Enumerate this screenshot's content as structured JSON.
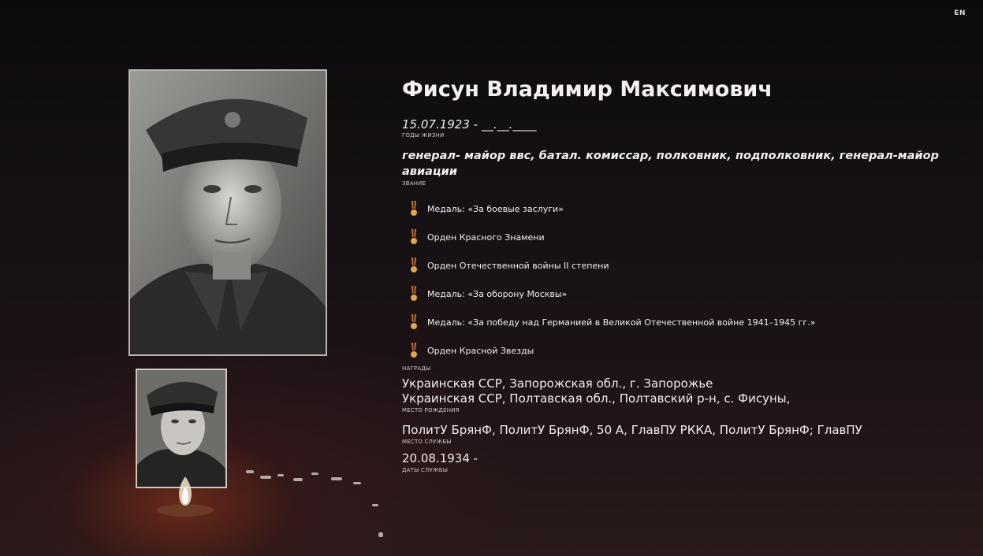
{
  "header": {
    "lang_label": "EN"
  },
  "person": {
    "name": "Фисун Владимир Максимович",
    "lifespan": "15.07.1923 - __.__.____",
    "lifespan_caption": "ГОДЫ ЖИЗНИ",
    "rank": "генерал- майор ввс, батал. комиссар, полковник, подполковник, генерал-майор авиации",
    "rank_caption": "ЗВАНИЕ",
    "awards": [
      "Медаль: «За боевые заслуги»",
      "Орден Красного Знамени",
      "Орден Отечественной войны II степени",
      "Медаль: «За оборону Москвы»",
      "Медаль: «За победу над Германией в Великой Отечественной войне 1941–1945 гг.»",
      "Орден Красной Звезды"
    ],
    "awards_caption": "НАГРАДЫ",
    "birthplace": [
      "Украинская ССР, Запорожская обл., г. Запорожье",
      "Украинская ССР, Полтавская обл., Полтавский р-н, с. Фисуны,"
    ],
    "birthplace_caption": "МЕСТО РОЖДЕНИЯ",
    "service_place": "ПолитУ БрянФ, ПолитУ БрянФ, 50 А, ГлавПУ РККА, ПолитУ БрянФ; ГлавПУ",
    "service_place_caption": "МЕСТО СЛУЖБЫ",
    "service_dates": "20.08.1934 -",
    "service_dates_caption": "ДАТЫ СЛУЖБЫ"
  },
  "colors": {
    "background": "#0a0709",
    "text": "#f2eeee",
    "medal_ribbon": "#c8763a",
    "medal_disc": "#e0a84a"
  },
  "icons": {
    "photo": "portrait-photo",
    "thumbnail": "portrait-thumbnail",
    "medal": "medal-icon",
    "flame": "eternal-flame-icon"
  }
}
